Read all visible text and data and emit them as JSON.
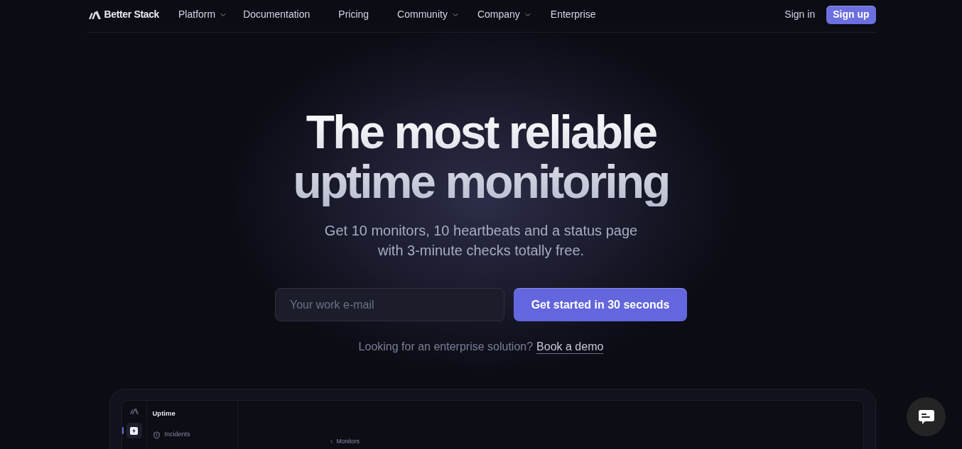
{
  "nav": {
    "brand": "Better Stack",
    "items": [
      {
        "label": "Platform",
        "dropdown": true
      },
      {
        "label": "Documentation",
        "dropdown": false
      },
      {
        "label": "Pricing",
        "dropdown": false
      },
      {
        "label": "Community",
        "dropdown": true
      },
      {
        "label": "Company",
        "dropdown": true
      },
      {
        "label": "Enterprise",
        "dropdown": false
      }
    ],
    "sign_in": "Sign in",
    "sign_up": "Sign up"
  },
  "hero": {
    "title": "The most reliable uptime monitoring",
    "subtitle": "Get 10 monitors, 10 heartbeats and a status page with 3-minute checks totally free.",
    "email": {
      "placeholder": "Your work e-mail"
    },
    "cta": "Get started in 30 seconds",
    "enterprise_note": "Looking for an enterprise solution?",
    "demo_link": "Book a demo"
  },
  "preview": {
    "app_title": "Uptime",
    "rail": [
      {
        "selected": true
      }
    ],
    "menu": [
      {
        "label": "Incidents"
      }
    ],
    "back_link": "Monitors"
  }
}
